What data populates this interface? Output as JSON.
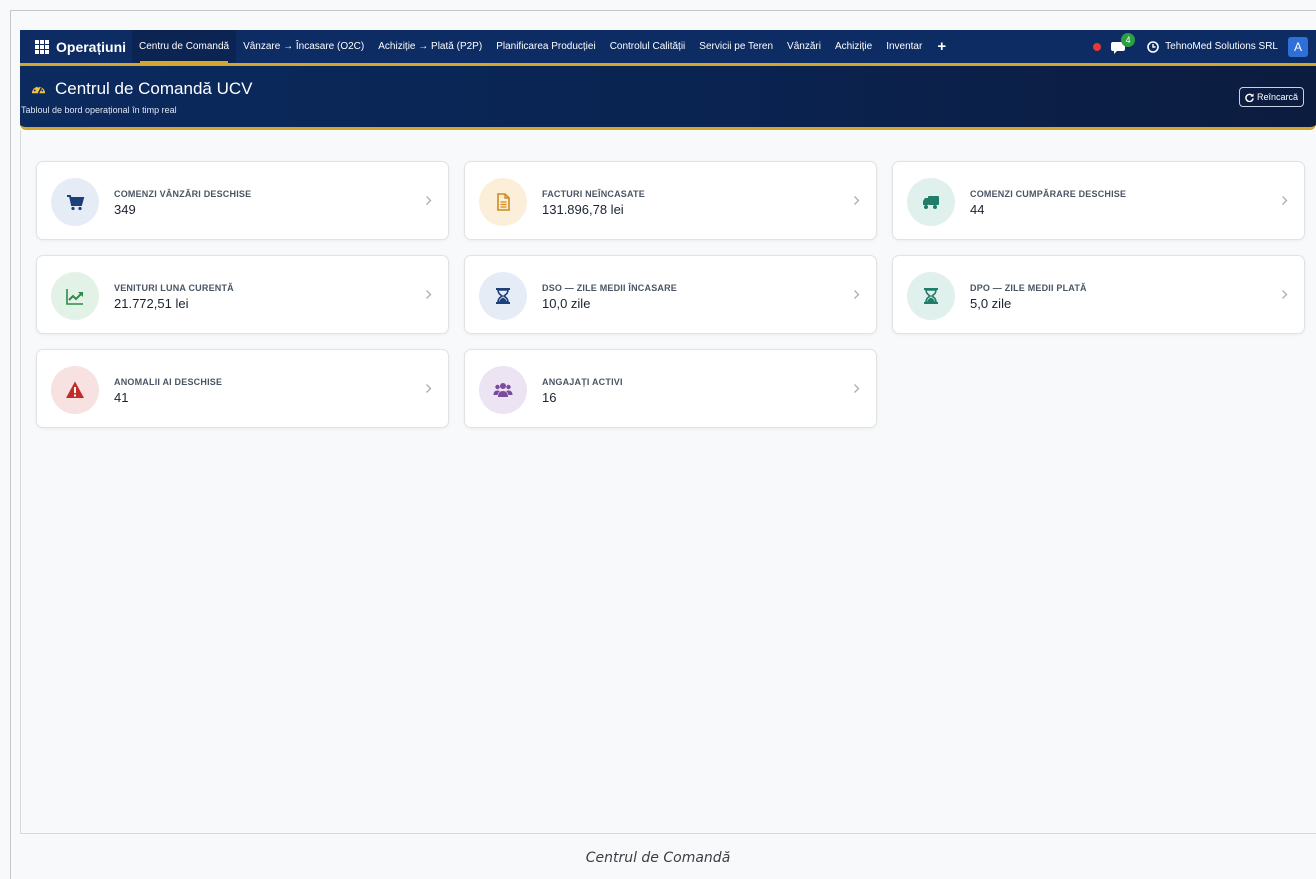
{
  "navbar": {
    "brand": "Operațiuni",
    "items": [
      {
        "label": "Centru de Comandă",
        "active": true
      },
      {
        "label": "Vânzare → Încasare (O2C)",
        "active": false
      },
      {
        "label": "Achiziție → Plată (P2P)",
        "active": false
      },
      {
        "label": "Planificarea Producției",
        "active": false
      },
      {
        "label": "Controlul Calității",
        "active": false
      },
      {
        "label": "Servicii pe Teren",
        "active": false
      },
      {
        "label": "Vânzări",
        "active": false
      },
      {
        "label": "Achiziție",
        "active": false
      },
      {
        "label": "Inventar",
        "active": false
      }
    ],
    "add_label": "+",
    "chat_badge": "4",
    "company": "TehnoMed Solutions SRL",
    "avatar": "A",
    "colors": {
      "bar": "#0d2c63",
      "accent": "#d4a72c",
      "status_dot": "#e53935",
      "badge": "#2e9e44",
      "avatar": "#2f6fd8"
    }
  },
  "header": {
    "title": "Centrul de Comandă UCV",
    "subtitle": "Tabloul de bord operațional în timp real",
    "reload_label": "Reîncarcă"
  },
  "cards": [
    {
      "label": "COMENZI VÂNZĂRI DESCHISE",
      "value": "349",
      "icon": "cart-icon",
      "bg": "#e6ecf6",
      "fg": "#1d3f7a"
    },
    {
      "label": "FACTURI NEÎNCASATE",
      "value": "131.896,78 lei",
      "icon": "invoice-icon",
      "bg": "#fbefd9",
      "fg": "#d08a1e"
    },
    {
      "label": "COMENZI CUMPĂRARE DESCHISE",
      "value": "44",
      "icon": "truck-icon",
      "bg": "#e0f0ec",
      "fg": "#1f7d6a"
    },
    {
      "label": "VENITURI LUNA CURENTĂ",
      "value": "21.772,51 lei",
      "icon": "trend-up-icon",
      "bg": "#e3f2e6",
      "fg": "#2e8b47"
    },
    {
      "label": "DSO — ZILE MEDII ÎNCASARE",
      "value": "10,0 zile",
      "icon": "hourglass-icon",
      "bg": "#e6ecf6",
      "fg": "#1d3f7a"
    },
    {
      "label": "DPO — ZILE MEDII PLATĂ",
      "value": "5,0 zile",
      "icon": "hourglass-icon",
      "bg": "#e0f0ec",
      "fg": "#1f7d6a"
    },
    {
      "label": "ANOMALII AI DESCHISE",
      "value": "41",
      "icon": "warning-icon",
      "bg": "#f7e1e1",
      "fg": "#c32b2b"
    },
    {
      "label": "ANGAJAȚI ACTIVI",
      "value": "16",
      "icon": "users-icon",
      "bg": "#ece3f3",
      "fg": "#7a4a9c"
    }
  ],
  "footer": {
    "caption": "Centrul de Comandă"
  }
}
